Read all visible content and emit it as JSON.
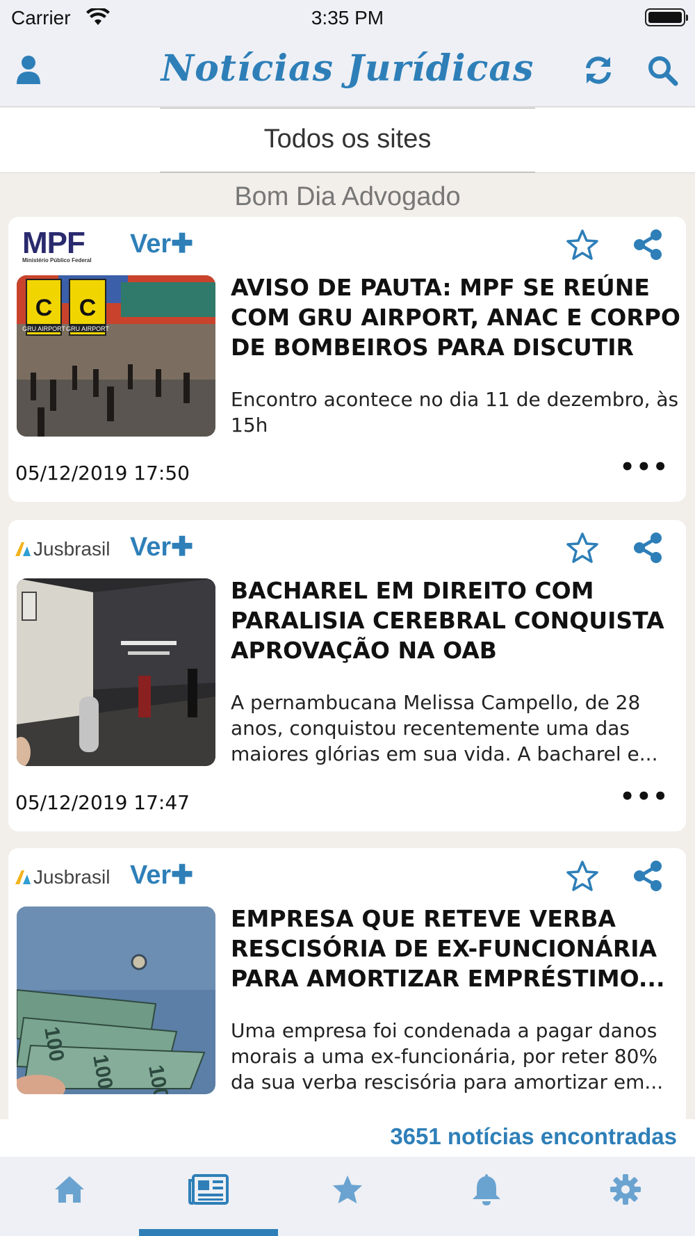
{
  "status_bar": {
    "carrier": "Carrier",
    "time": "3:35 PM"
  },
  "nav": {
    "title": "Notícias Jurídicas",
    "left_icon": "user-icon",
    "right_icons": [
      "refresh-icon",
      "search-icon"
    ]
  },
  "filter": {
    "label": "Todos os sites"
  },
  "banner": {
    "text": "Bom Dia Advogado"
  },
  "colors": {
    "accent": "#2e7fb8",
    "background": "#f2eee9",
    "card": "#ffffff",
    "bar": "#eef0f5"
  },
  "articles": [
    {
      "source": "MPF",
      "source_subtitle": "Ministério Público Federal",
      "ver_mais": "Ver",
      "headline": "AVISO DE PAUTA: MPF SE REÚNE COM GRU AIRPORT, ANAC E CORPO DE BOMBEIROS PARA DISCUTIR A...",
      "summary": "Encontro acontece no dia 11 de dezembro, às 15h",
      "date": "05/12/2019 17:50",
      "image_labels": [
        "C",
        "C",
        "GRU AIRPORT",
        "GRU AIRPORT"
      ]
    },
    {
      "source": "Jusbrasil",
      "ver_mais": "Ver",
      "headline": "BACHAREL EM DIREITO COM PARALISIA CEREBRAL CONQUISTA APROVAÇÃO NA OAB",
      "summary": "A pernambucana Melissa Campello, de 28 anos, conquistou recentemente uma das maiores glórias em sua vida. A bacharel e...",
      "date": "05/12/2019 17:47"
    },
    {
      "source": "Jusbrasil",
      "ver_mais": "Ver",
      "headline": "EMPRESA QUE RETEVE VERBA RESCISÓRIA DE EX-FUNCIONÁRIA PARA AMORTIZAR EMPRÉSTIMO...",
      "summary": "Uma empresa foi condenada a pagar danos morais a uma ex-funcionária, por reter 80% da sua verba rescisória para amortizar em...",
      "image_labels": [
        "100",
        "100",
        "100"
      ]
    }
  ],
  "footer": {
    "count_text": "3651 notícias encontradas"
  },
  "tabs": [
    {
      "name": "home",
      "icon": "home-icon"
    },
    {
      "name": "news",
      "icon": "newspaper-icon",
      "selected": true
    },
    {
      "name": "favorites",
      "icon": "star-icon"
    },
    {
      "name": "notifications",
      "icon": "bell-icon"
    },
    {
      "name": "settings",
      "icon": "gear-icon"
    }
  ]
}
